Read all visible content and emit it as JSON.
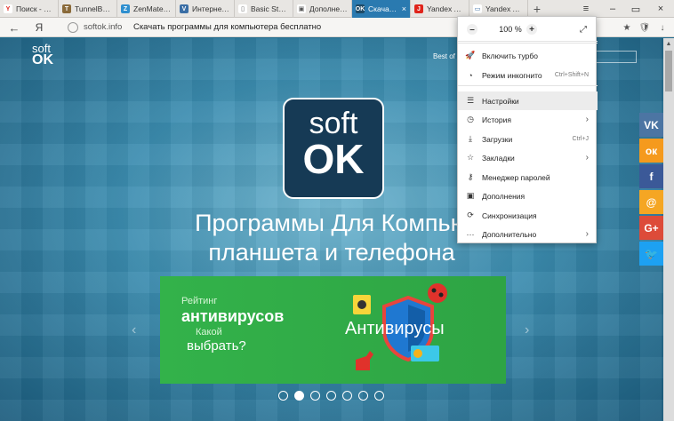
{
  "tabs": [
    {
      "title": "Поиск - Раси",
      "favicon": "yandex-icon",
      "color": "#ffffff",
      "glyph": "Y",
      "fgcolor": "#e0241b"
    },
    {
      "title": "TunnelBear",
      "favicon": "bear-icon",
      "color": "#8a6a3a",
      "glyph": "T",
      "fgcolor": "#ffffff"
    },
    {
      "title": "ZenMate - и",
      "favicon": "zenmate-icon",
      "color": "#2f8fcf",
      "glyph": "Z",
      "fgcolor": "#ffffff"
    },
    {
      "title": "Интернет-б",
      "favicon": "shield-icon",
      "color": "#3a6ea5",
      "glyph": "V",
      "fgcolor": "#ffffff"
    },
    {
      "title": "Basic Step by",
      "favicon": "page-icon",
      "color": "#ffffff",
      "glyph": "▯",
      "fgcolor": "#666666"
    },
    {
      "title": "Дополнени",
      "favicon": "addons-icon",
      "color": "#ffffff",
      "glyph": "▣",
      "fgcolor": "#555555"
    },
    {
      "title": "Скачать п",
      "favicon": "softok-icon",
      "color": "#1e4a66",
      "glyph": "OK",
      "fgcolor": "#ffffff",
      "active": true
    },
    {
      "title": "Yandex Acce",
      "favicon": "yandex-red-icon",
      "color": "#e0241b",
      "glyph": "J",
      "fgcolor": "#ffffff"
    },
    {
      "title": "Yandex Acce",
      "favicon": "page-icon",
      "color": "#ffffff",
      "glyph": "▭",
      "fgcolor": "#3a6ea5"
    }
  ],
  "tab_close": "×",
  "new_tab": "+",
  "window": {
    "menu": "≡",
    "minimize": "–",
    "close": "×"
  },
  "address": {
    "back": "←",
    "yandex": "Я",
    "domain": "softok.info",
    "page_title": "Скачать программы для компьютера бесплатно",
    "icons": {
      "bookmark": "★",
      "protect": "🛡",
      "downloads": "↓"
    }
  },
  "site": {
    "logo_top": "soft",
    "logo_bottom": "OK",
    "best": "Best of",
    "big_logo_top": "soft",
    "big_logo_bottom": "OK",
    "headline_1": "Программы Для Компью",
    "headline_2": "планшета и телефона",
    "banner": {
      "line1": "Рейтинг",
      "line2": "антивирусов",
      "line3": "Какой",
      "line4": "выбрать?",
      "title": "Антивирусы"
    },
    "arrow_left": "‹",
    "arrow_right": "›",
    "slider_dots": 7,
    "active_dot": 1,
    "social": [
      {
        "name": "vk",
        "glyph": "VK",
        "color": "#4c75a3"
      },
      {
        "name": "odnoklassniki",
        "glyph": "ок",
        "color": "#f59a1d"
      },
      {
        "name": "facebook",
        "glyph": "f",
        "color": "#3b5998"
      },
      {
        "name": "mail",
        "glyph": "@",
        "color": "#f5a623"
      },
      {
        "name": "google-plus",
        "glyph": "G+",
        "color": "#dd4b39"
      },
      {
        "name": "twitter",
        "glyph": "🐦",
        "color": "#1da1f2"
      }
    ]
  },
  "menu": {
    "zoom_minus": "–",
    "zoom_value": "100 %",
    "zoom_plus": "+",
    "fullscreen": "⤢",
    "items": [
      {
        "label": "Включить турбо",
        "icon": "rocket-icon",
        "glyph": "🚀",
        "shortcut": "",
        "arrow": false
      },
      {
        "label": "Режим инкогнито",
        "icon": "incognito-icon",
        "glyph": "◔",
        "shortcut": "Ctrl+Shift+N",
        "arrow": false
      },
      {
        "label": "Настройки",
        "icon": "settings-icon",
        "glyph": "☰",
        "shortcut": "",
        "arrow": false,
        "highlight": true
      },
      {
        "label": "История",
        "icon": "history-icon",
        "glyph": "◷",
        "shortcut": "",
        "arrow": true
      },
      {
        "label": "Загрузки",
        "icon": "download-icon",
        "glyph": "⤓",
        "shortcut": "Ctrl+J",
        "arrow": false
      },
      {
        "label": "Закладки",
        "icon": "bookmark-icon",
        "glyph": "☆",
        "shortcut": "",
        "arrow": true
      },
      {
        "label": "Менеджер паролей",
        "icon": "key-icon",
        "glyph": "⚷",
        "shortcut": "",
        "arrow": false
      },
      {
        "label": "Дополнения",
        "icon": "extensions-icon",
        "glyph": "▣",
        "shortcut": "",
        "arrow": false
      },
      {
        "label": "Синхронизация",
        "icon": "sync-icon",
        "glyph": "⟳",
        "shortcut": "",
        "arrow": false
      },
      {
        "label": "Дополнительно",
        "icon": "more-icon",
        "glyph": "···",
        "shortcut": "",
        "arrow": true
      }
    ],
    "chevron": "›"
  }
}
